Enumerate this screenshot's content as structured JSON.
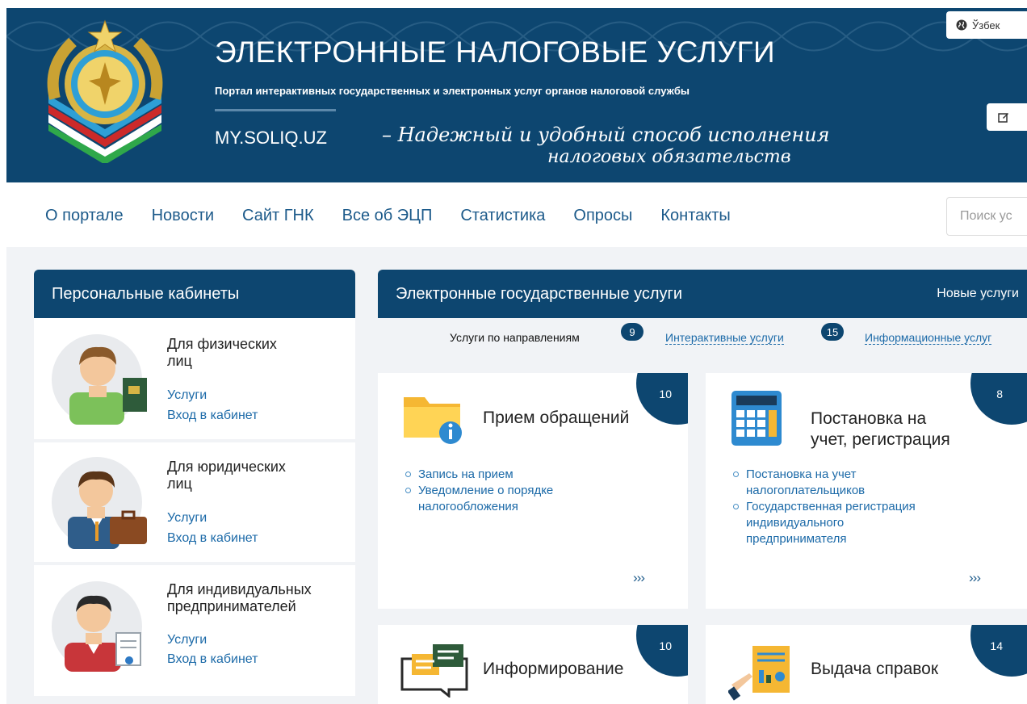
{
  "header": {
    "title": "ЭЛЕКТРОННЫЕ НАЛОГОВЫЕ УСЛУГИ",
    "subtitle": "Портал интерактивных государственных и электронных услуг органов налоговой службы",
    "slogan_domain": "MY.SOLIQ.UZ",
    "slogan_line1": "– Надежный и удобный способ исполнения",
    "slogan_line2": "налоговых обязательств",
    "lang_label": "Ўзбек",
    "lang_icon": "globe-icon",
    "edit_icon": "edit-icon"
  },
  "nav": {
    "items": [
      {
        "label": "О портале"
      },
      {
        "label": "Новости"
      },
      {
        "label": "Сайт ГНК"
      },
      {
        "label": "Все об ЭЦП"
      },
      {
        "label": "Статистика"
      },
      {
        "label": "Опросы"
      },
      {
        "label": "Контакты"
      }
    ],
    "search_placeholder": "Поиск ус"
  },
  "cabinets": {
    "title": "Персональные кабинеты",
    "items": [
      {
        "title_line1": "Для физических",
        "title_line2": "лиц",
        "services": "Услуги",
        "login": "Вход в кабинет",
        "icon": "individual-person-icon"
      },
      {
        "title_line1": "Для юридических",
        "title_line2": "лиц",
        "services": "Услуги",
        "login": "Вход в кабинет",
        "icon": "business-person-icon"
      },
      {
        "title_line1": "Для индивидуальных",
        "title_line2": "предпринимателей",
        "services": "Услуги",
        "login": "Вход в кабинет",
        "icon": "entrepreneur-icon"
      }
    ]
  },
  "services": {
    "title": "Электронные государственные услуги",
    "new_services": "Новые услуги",
    "tabs": [
      {
        "label": "Услуги по направлениям",
        "count": "9"
      },
      {
        "label": "Интерактивные услуги",
        "count": "15"
      },
      {
        "label": "Информационные услуг"
      }
    ],
    "cards": [
      {
        "title_line1": "Прием обращений",
        "count": "10",
        "icon": "folder-info-icon",
        "items": [
          "Запись на прием",
          "Уведомление о порядке",
          "налогообложения"
        ],
        "more": "›››"
      },
      {
        "title_line1": "Постановка на",
        "title_line2": "учет, регистрация",
        "count": "8",
        "icon": "calculator-icon",
        "items": [
          "Постановка на учет",
          "налогоплательщиков",
          "Государственная регистрация",
          "индивидуального",
          "предпринимателя"
        ],
        "more": "›››"
      },
      {
        "title_line1": "Информирование",
        "count": "10",
        "icon": "chat-bubbles-icon"
      },
      {
        "title_line1": "Выдача справок",
        "count": "14",
        "icon": "certificate-icon"
      }
    ]
  },
  "colors": {
    "primary": "#0d4670",
    "link": "#1c6aa8",
    "background": "#f1f3f6"
  }
}
